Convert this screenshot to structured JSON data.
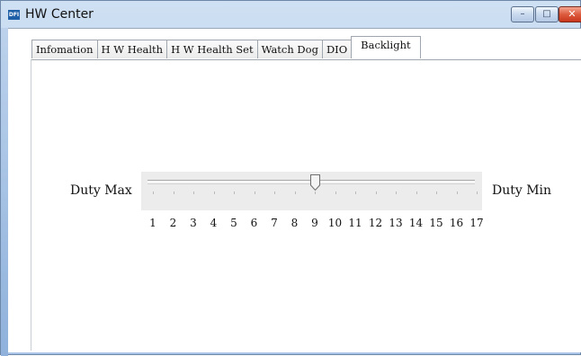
{
  "window": {
    "title": "HW Center",
    "app_icon_text": "DFI",
    "controls": {
      "minimize": "–",
      "maximize": "□",
      "close": "✕"
    }
  },
  "tabs": [
    {
      "label": "Infomation",
      "active": false
    },
    {
      "label": "H W Health",
      "active": false
    },
    {
      "label": "H W Health Set",
      "active": false
    },
    {
      "label": "Watch Dog",
      "active": false
    },
    {
      "label": "DIO",
      "active": false
    },
    {
      "label": "Backlight",
      "active": true
    }
  ],
  "backlight": {
    "left_label": "Duty Max",
    "right_label": "Duty Min",
    "slider": {
      "min": 1,
      "max": 17,
      "value": 9
    },
    "scale": [
      "1",
      "2",
      "3",
      "4",
      "5",
      "6",
      "7",
      "8",
      "9",
      "10",
      "11",
      "12",
      "13",
      "14",
      "15",
      "16",
      "17"
    ]
  },
  "colors": {
    "titlebar": "#b9d1ec",
    "close_button": "#dd5b3e",
    "slider_background": "#ececec"
  },
  "icons": {
    "app": "dfi-app-icon",
    "thumb": "slider-thumb-icon"
  }
}
